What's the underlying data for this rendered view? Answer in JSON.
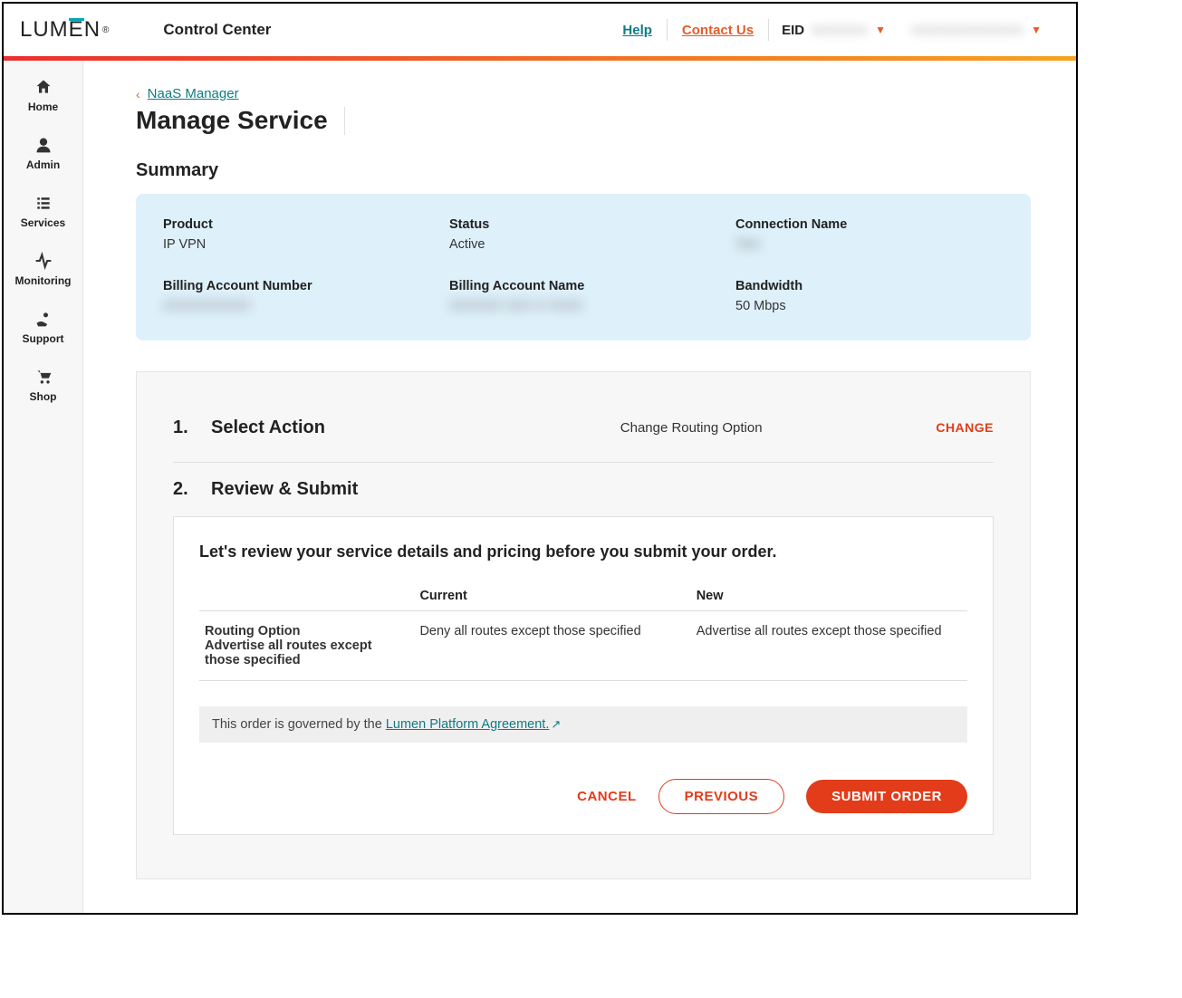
{
  "header": {
    "logo_text": "LUMEN",
    "cc_label": "Control Center",
    "help": "Help",
    "contact": "Contact Us",
    "eid_label": "EID",
    "eid_value": "XXXXXX",
    "account_value": "XXXXXXXXXXXX"
  },
  "sidebar": {
    "items": [
      {
        "label": "Home"
      },
      {
        "label": "Admin"
      },
      {
        "label": "Services"
      },
      {
        "label": "Monitoring"
      },
      {
        "label": "Support"
      },
      {
        "label": "Shop"
      }
    ]
  },
  "breadcrumb": {
    "back_label": "NaaS Manager"
  },
  "page": {
    "title": "Manage Service",
    "summary_heading": "Summary"
  },
  "summary": {
    "product_label": "Product",
    "product_value": "IP VPN",
    "status_label": "Status",
    "status_value": "Active",
    "conn_label": "Connection Name",
    "conn_value": "Test",
    "ban_label": "Billing Account Number",
    "ban_value": "XXXXXXXXXX",
    "baname_label": "Billing Account Name",
    "baname_value": "XXXXXX XXX X XXXX",
    "bw_label": "Bandwidth",
    "bw_value": "50 Mbps"
  },
  "steps": {
    "one_num": "1.",
    "one_title": "Select Action",
    "one_value": "Change Routing Option",
    "change": "CHANGE",
    "two_num": "2.",
    "two_title": "Review & Submit"
  },
  "review": {
    "heading": "Let's review your service details and pricing before you submit your order.",
    "col_current": "Current",
    "col_new": "New",
    "row_label": "Routing Option",
    "row_sub": "Advertise all routes except those specified",
    "row_current": "Deny all routes except those specified",
    "row_new": "Advertise all routes except those specified",
    "agreement_pre": "This order is governed by the ",
    "agreement_link": "Lumen Platform Agreement."
  },
  "buttons": {
    "cancel": "CANCEL",
    "previous": "PREVIOUS",
    "submit": "SUBMIT ORDER"
  }
}
